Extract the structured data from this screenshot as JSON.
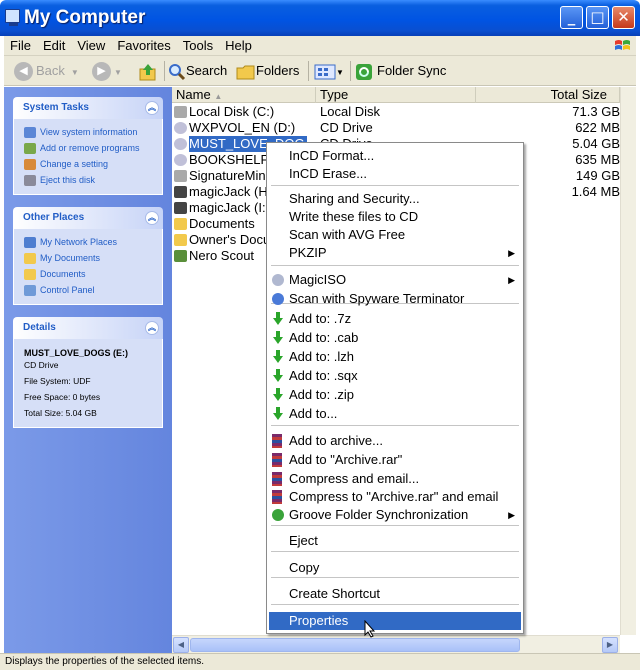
{
  "window": {
    "title": "My Computer"
  },
  "menubar": [
    "File",
    "Edit",
    "View",
    "Favorites",
    "Tools",
    "Help"
  ],
  "toolbar": {
    "back_label": "Back",
    "search_label": "Search",
    "folders_label": "Folders",
    "folder_sync_label": "Folder Sync"
  },
  "system_tasks": {
    "title": "System Tasks",
    "items": [
      "View system information",
      "Add or remove programs",
      "Change a setting",
      "Eject this disk"
    ]
  },
  "other_places": {
    "title": "Other Places",
    "items": [
      "My Network Places",
      "My Documents",
      "Documents",
      "Control Panel"
    ]
  },
  "details": {
    "title": "Details",
    "name": "MUST_LOVE_DOGS (E:)",
    "type": "CD Drive",
    "file_system": "File System: UDF",
    "free_space": "Free Space: 0 bytes",
    "total_size": "Total Size: 5.04 GB"
  },
  "columns": {
    "name": "Name",
    "type": "Type",
    "total_size": "Total Size"
  },
  "rows": [
    {
      "name": "Local Disk (C:)",
      "type": "Local Disk",
      "size": "71.3 GB",
      "icon": "hard-disk-icon"
    },
    {
      "name": "WXPVOL_EN (D:)",
      "type": "CD Drive",
      "size": "622 MB",
      "icon": "cd-drive-icon"
    },
    {
      "name": "MUST_LOVE_DOG",
      "type": "CD Drive",
      "size": "5.04 GB",
      "icon": "cd-drive-icon"
    },
    {
      "name": "BOOKSHELF9",
      "type": "",
      "size": "635 MB",
      "icon": "cd-drive-icon"
    },
    {
      "name": "SignatureMini",
      "type": "",
      "size": "149 GB",
      "icon": "hard-disk-icon"
    },
    {
      "name": "magicJack (H:",
      "type": "",
      "size": "1.64 MB",
      "icon": "drive-icon"
    },
    {
      "name": "magicJack (I:",
      "type": "",
      "size": "",
      "icon": "drive-icon"
    },
    {
      "name": "Documents",
      "type": "",
      "size": "",
      "icon": "folder-icon"
    },
    {
      "name": "Owner's Docu",
      "type": "",
      "size": "",
      "icon": "folder-icon"
    },
    {
      "name": "Nero Scout",
      "type": "",
      "size": "",
      "icon": "nero-icon"
    }
  ],
  "context_menu": {
    "items": [
      "InCD Format...",
      "InCD Erase...",
      "Sharing and Security...",
      "Write these files to CD",
      "Scan with AVG Free",
      "PKZIP",
      "MagicISO",
      "Scan with Spyware Terminator",
      "Add to: .7z",
      "Add to: .cab",
      "Add to: .lzh",
      "Add to: .sqx",
      "Add to: .zip",
      "Add to...",
      "Add to archive...",
      "Add to \"Archive.rar\"",
      "Compress and email...",
      "Compress to \"Archive.rar\" and email",
      "Groove Folder Synchronization",
      "Eject",
      "Copy",
      "Create Shortcut",
      "Properties"
    ],
    "highlighted": "Properties"
  },
  "status": {
    "text": "Displays the properties of the selected items."
  }
}
